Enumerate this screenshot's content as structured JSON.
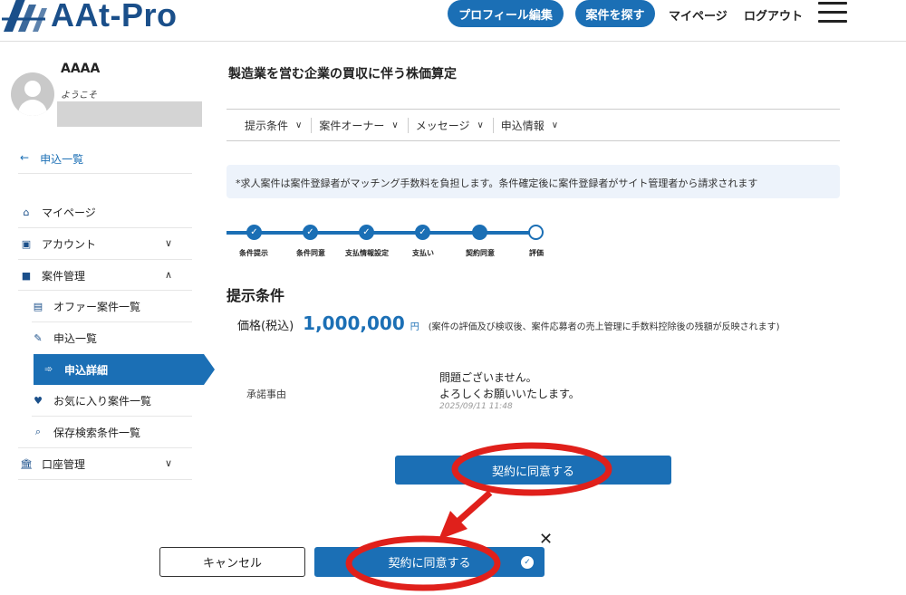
{
  "header": {
    "logo_text": "AAt-Pro",
    "profile_button": "プロフィール編集",
    "search_button": "案件を探す",
    "mypage_link": "マイページ",
    "logout_link": "ログアウト"
  },
  "sidebar": {
    "user_name": "AAAA",
    "welcome": "ようこそ",
    "back_link": "申込一覧",
    "back_arrow": "←",
    "items": [
      {
        "label": "マイページ"
      },
      {
        "label": "アカウント"
      },
      {
        "label": "案件管理"
      },
      {
        "label": "オファー案件一覧"
      },
      {
        "label": "申込一覧"
      },
      {
        "label": "申込詳細"
      },
      {
        "label": "お気に入り案件一覧"
      },
      {
        "label": "保存検索条件一覧"
      },
      {
        "label": "口座管理"
      }
    ]
  },
  "main": {
    "title": "製造業を営む企業の買収に伴う株価算定",
    "tabs": [
      "提示条件",
      "案件オーナー",
      "メッセージ",
      "申込情報"
    ],
    "notice": "*求人案件は案件登録者がマッチング手数料を負担します。条件確定後に案件登録者がサイト管理者から請求されます",
    "steps": [
      {
        "label": "条件提示",
        "done": true
      },
      {
        "label": "条件同意",
        "done": true
      },
      {
        "label": "支払情報設定",
        "done": true
      },
      {
        "label": "支払い",
        "done": true
      },
      {
        "label": "契約同意",
        "done": true
      },
      {
        "label": "評価",
        "done": false
      }
    ],
    "section_title": "提示条件",
    "price_label": "価格(税込)",
    "price_value": "1,000,000",
    "price_unit": "円",
    "price_note": "(案件の評価及び検収後、案件応募者の売上管理に手数料控除後の残額が反映されます)",
    "reason_label": "承諾事由",
    "reason_line1": "問題ございません。",
    "reason_line2": "よろしくお願いいたします。",
    "reason_date": "2025/09/11 11:48",
    "agree_button": "契約に同意する"
  },
  "modal": {
    "cancel_button": "キャンセル",
    "agree_button": "契約に同意する",
    "close_symbol": "✕"
  },
  "colors": {
    "primary": "#1b6fb5",
    "annotation": "#e0201b"
  }
}
